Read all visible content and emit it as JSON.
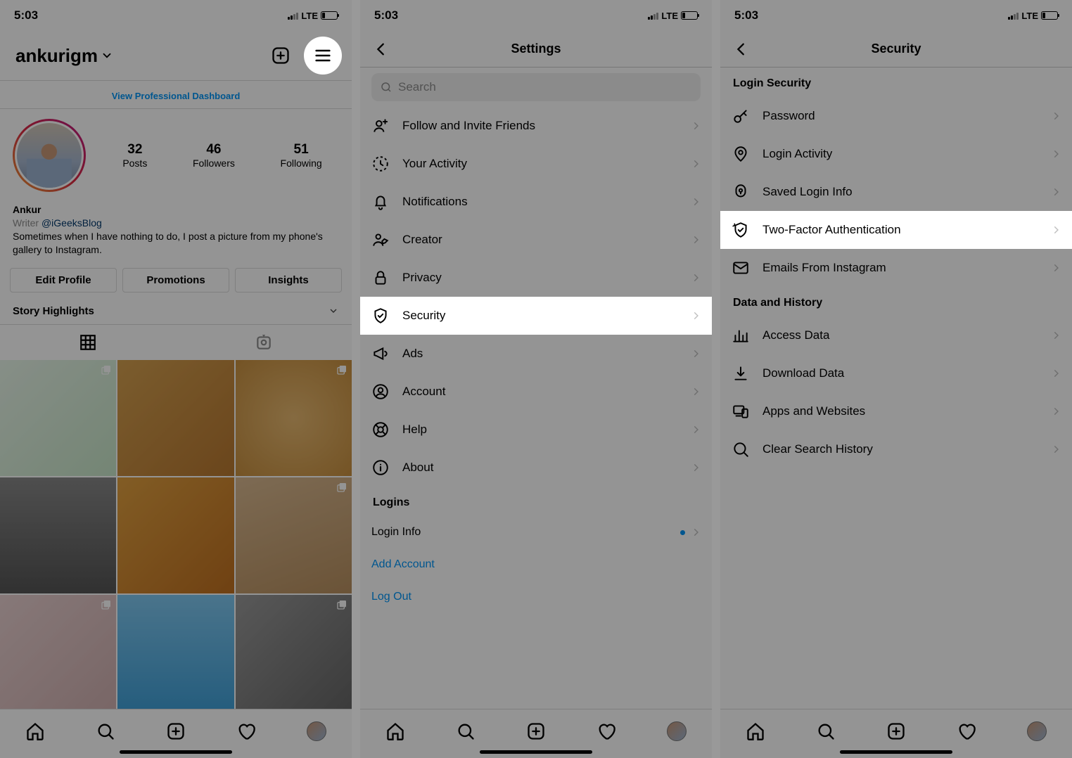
{
  "status": {
    "time": "5:03",
    "network": "LTE"
  },
  "screen1": {
    "username": "ankurigm",
    "dashboard_link": "View Professional Dashboard",
    "stats": {
      "posts": {
        "num": "32",
        "label": "Posts"
      },
      "followers": {
        "num": "46",
        "label": "Followers"
      },
      "following": {
        "num": "51",
        "label": "Following"
      }
    },
    "bio": {
      "name": "Ankur",
      "role": "Writer",
      "handle": "@iGeeksBlog",
      "desc": "Sometimes when I have nothing to do, I post a picture from my phone's gallery to Instagram."
    },
    "buttons": {
      "edit": "Edit Profile",
      "promo": "Promotions",
      "insights": "Insights"
    },
    "highlights_label": "Story Highlights"
  },
  "screen2": {
    "title": "Settings",
    "search_placeholder": "Search",
    "rows": {
      "follow": "Follow and Invite Friends",
      "activity": "Your Activity",
      "notifications": "Notifications",
      "creator": "Creator",
      "privacy": "Privacy",
      "security": "Security",
      "ads": "Ads",
      "account": "Account",
      "help": "Help",
      "about": "About"
    },
    "logins_header": "Logins",
    "login_info": "Login Info",
    "add_account": "Add Account",
    "log_out": "Log Out"
  },
  "screen3": {
    "title": "Security",
    "section1": "Login Security",
    "rows1": {
      "password": "Password",
      "login_activity": "Login Activity",
      "saved_login": "Saved Login Info",
      "two_factor": "Two-Factor Authentication",
      "emails": "Emails From Instagram"
    },
    "section2": "Data and History",
    "rows2": {
      "access_data": "Access Data",
      "download_data": "Download Data",
      "apps_websites": "Apps and Websites",
      "clear_search": "Clear Search History"
    }
  }
}
